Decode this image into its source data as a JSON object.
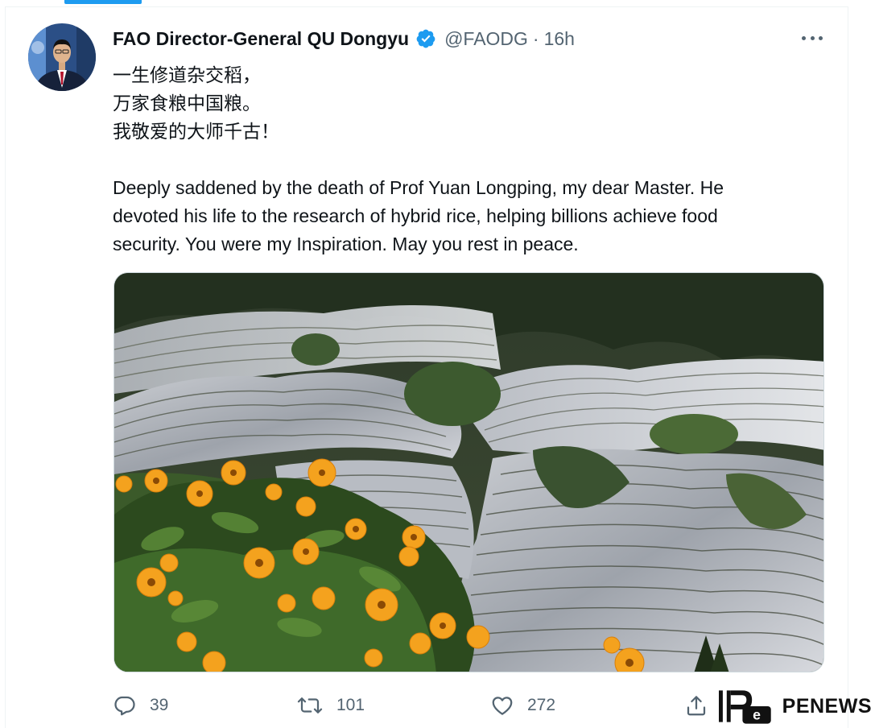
{
  "tweet": {
    "display_name": "FAO Director-General QU Dongyu",
    "handle": "@FAODG",
    "separator": "·",
    "time": "16h",
    "lines": [
      "一生修道杂交稻，",
      "万家食粮中国粮。",
      "我敬爱的大师千古！"
    ],
    "paragraph_lines": [
      "Deeply saddened by the death of Prof Yuan Longping, my dear Master. He",
      "devoted his life to the research of hybrid rice, helping billions achieve food",
      "security. You were my Inspiration. May you rest in peace."
    ],
    "media_caption": "rice terraces with yellow flowers in foreground"
  },
  "actions": {
    "reply_count": "39",
    "retweet_count": "101",
    "like_count": "272"
  },
  "icons": {
    "verified": "verified-badge-icon",
    "more": "more-icon",
    "reply": "reply-icon",
    "retweet": "retweet-icon",
    "like": "heart-icon",
    "share": "share-icon"
  },
  "watermark": {
    "brand": "PENEWS"
  },
  "colors": {
    "accent": "#1d9bf0",
    "secondary_text": "#536471",
    "flower": "#f6a623"
  }
}
